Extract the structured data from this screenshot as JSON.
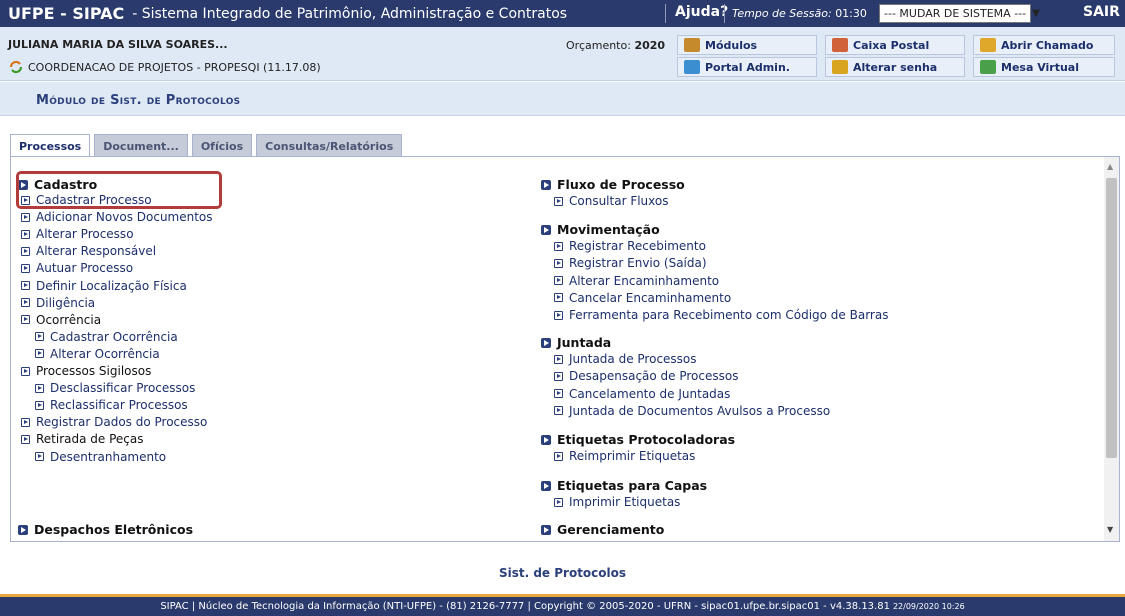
{
  "header": {
    "system_title": "UFPE - SIPAC",
    "system_subtitle": "- Sistema Integrado de Patrimônio, Administração e Contratos",
    "help_label": "Ajuda?",
    "session_label": "Tempo de Sessão:",
    "session_time": "01:30",
    "change_system_label": "--- MUDAR DE SISTEMA ---",
    "logout_label": "SAIR"
  },
  "user": {
    "name": "JULIANA MARIA DA SILVA SOARES...",
    "unit": "COORDENACAO DE PROJETOS - PROPESQI (11.17.08)",
    "budget_label": "Orçamento:",
    "budget_year": "2020"
  },
  "quick_links": [
    {
      "label": "Módulos",
      "icon": "modules-icon"
    },
    {
      "label": "Caixa Postal",
      "icon": "mailbox-icon"
    },
    {
      "label": "Abrir Chamado",
      "icon": "ticket-icon"
    },
    {
      "label": "Portal Admin.",
      "icon": "portal-icon"
    },
    {
      "label": "Alterar senha",
      "icon": "password-icon"
    },
    {
      "label": "Mesa Virtual",
      "icon": "desk-icon"
    }
  ],
  "module_title": "Módulo de Sist. de Protocolos",
  "tabs": [
    {
      "label": "Processos",
      "active": true
    },
    {
      "label": "Document...",
      "active": false
    },
    {
      "label": "Ofícios",
      "active": false
    },
    {
      "label": "Consultas/Relatórios",
      "active": false
    }
  ],
  "left": {
    "cadastro": "Cadastro",
    "items": [
      "Cadastrar Processo",
      "Adicionar Novos Documentos",
      "Alterar Processo",
      "Alterar Responsável",
      "Autuar Processo",
      "Definir Localização Física",
      "Diligência",
      "Ocorrência",
      "Cadastrar Ocorrência",
      "Alterar Ocorrência",
      "Processos Sigilosos",
      "Desclassificar Processos",
      "Reclassificar Processos",
      "Registrar Dados do Processo",
      "Retirada de Peças",
      "Desentranhamento"
    ],
    "despachos": "Despachos Eletrônicos"
  },
  "right": {
    "fluxo": "Fluxo de Processo",
    "fluxo_items": [
      "Consultar Fluxos"
    ],
    "movimentacao": "Movimentação",
    "mov_items": [
      "Registrar Recebimento",
      "Registrar Envio (Saída)",
      "Alterar Encaminhamento",
      "Cancelar Encaminhamento",
      "Ferramenta para Recebimento com Código de Barras"
    ],
    "juntada": "Juntada",
    "juntada_items": [
      "Juntada de Processos",
      "Desapensação de Processos",
      "Cancelamento de Juntadas",
      "Juntada de Documentos Avulsos a Processo"
    ],
    "etiquetas": "Etiquetas Protocoladoras",
    "etiquetas_items": [
      "Reimprimir Etiquetas"
    ],
    "capas": "Etiquetas para Capas",
    "capas_items": [
      "Imprimir Etiquetas"
    ],
    "gerenciamento": "Gerenciamento"
  },
  "footer": {
    "module_link": "Sist. de Protocolos",
    "text": "SIPAC | Núcleo de Tecnologia da Informação (NTI-UFPE) - (81) 2126-7777 | Copyright © 2005-2020 - UFRN - sipac01.ufpe.br.sipac01 - v4.38.13.81",
    "date": "22/09/2020 10:26"
  },
  "colors": {
    "header_bg": "#2a3a6c",
    "accent": "#b23b3b",
    "footer_stripe": "#e8a53a"
  }
}
